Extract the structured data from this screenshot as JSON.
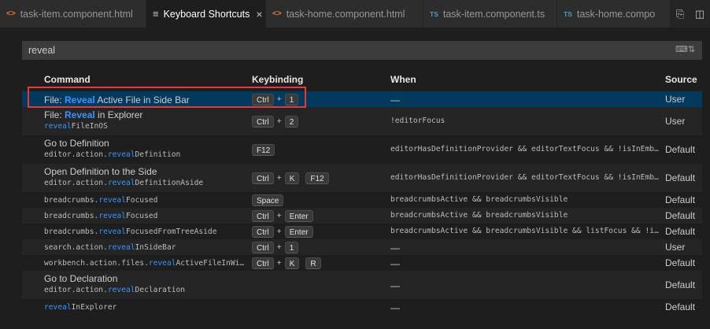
{
  "tabs": [
    {
      "icon": "html-file-icon",
      "glyph": "<>",
      "label": "task-item.component.html",
      "active": false
    },
    {
      "icon": "keyboard-shortcuts-icon",
      "glyph": "≡",
      "label": "Keyboard Shortcuts",
      "active": true
    },
    {
      "icon": "html-file-icon",
      "glyph": "<>",
      "label": "task-home.component.html",
      "active": false
    },
    {
      "icon": "ts-file-icon",
      "glyph": "TS",
      "label": "task-item.component.ts",
      "active": false
    },
    {
      "icon": "ts-file-icon",
      "glyph": "TS",
      "label": "task-home.compo",
      "active": false
    }
  ],
  "search": {
    "value": "reveal"
  },
  "columns": {
    "command": "Command",
    "keybinding": "Keybinding",
    "when": "When",
    "source": "Source"
  },
  "rows": [
    {
      "cmd": [
        "File: ",
        "Reveal",
        " Active File in Side Bar"
      ],
      "id": null,
      "keys": [
        [
          "Ctrl",
          "1"
        ]
      ],
      "when": "—",
      "source": "User",
      "selected": true
    },
    {
      "cmd": [
        "File: ",
        "Reveal",
        " in Explorer"
      ],
      "id": [
        "",
        "reveal",
        "FileInOS"
      ],
      "keys": [
        [
          "Ctrl",
          "2"
        ]
      ],
      "when": "!editorFocus",
      "source": "User"
    },
    {
      "cmd": [
        "Go to Definition",
        "",
        ""
      ],
      "id": [
        "editor.action.",
        "reveal",
        "Definition"
      ],
      "keys": [
        [
          "F12"
        ]
      ],
      "when": "editorHasDefinitionProvider && editorTextFocus && !isInEmb…",
      "source": "Default"
    },
    {
      "cmd": [
        "Open Definition to the Side",
        "",
        ""
      ],
      "id": [
        "editor.action.",
        "reveal",
        "DefinitionAside"
      ],
      "keys": [
        [
          "Ctrl",
          "K"
        ],
        [
          "F12"
        ]
      ],
      "when": "editorHasDefinitionProvider && editorTextFocus && !isInEmb…",
      "source": "Default"
    },
    {
      "cmd": [
        "breadcrumbs.",
        "reveal",
        "Focused"
      ],
      "mono": true,
      "id": null,
      "keys": [
        [
          "Space"
        ]
      ],
      "when": "breadcrumbsActive && breadcrumbsVisible",
      "source": "Default"
    },
    {
      "cmd": [
        "breadcrumbs.",
        "reveal",
        "Focused"
      ],
      "mono": true,
      "id": null,
      "keys": [
        [
          "Ctrl",
          "Enter"
        ]
      ],
      "when": "breadcrumbsActive && breadcrumbsVisible",
      "source": "Default"
    },
    {
      "cmd": [
        "breadcrumbs.",
        "reveal",
        "FocusedFromTreeAside"
      ],
      "mono": true,
      "id": null,
      "keys": [
        [
          "Ctrl",
          "Enter"
        ]
      ],
      "when": "breadcrumbsActive && breadcrumbsVisible && listFocus && !i…",
      "source": "Default"
    },
    {
      "cmd": [
        "search.action.",
        "reveal",
        "InSideBar"
      ],
      "mono": true,
      "id": null,
      "keys": [
        [
          "Ctrl",
          "1"
        ]
      ],
      "when": "—",
      "source": "User"
    },
    {
      "cmd": [
        "workbench.action.files.",
        "reveal",
        "ActiveFileInWi…"
      ],
      "mono": true,
      "id": null,
      "keys": [
        [
          "Ctrl",
          "K"
        ],
        [
          "R"
        ]
      ],
      "when": "—",
      "source": "Default"
    },
    {
      "cmd": [
        "Go to Declaration",
        "",
        ""
      ],
      "id": [
        "editor.action.",
        "reveal",
        "Declaration"
      ],
      "keys": [],
      "when": "—",
      "source": "Default"
    },
    {
      "cmd": [
        "",
        "reveal",
        "InExplorer"
      ],
      "mono": true,
      "id": null,
      "keys": [],
      "when": "—",
      "source": "Default"
    }
  ]
}
